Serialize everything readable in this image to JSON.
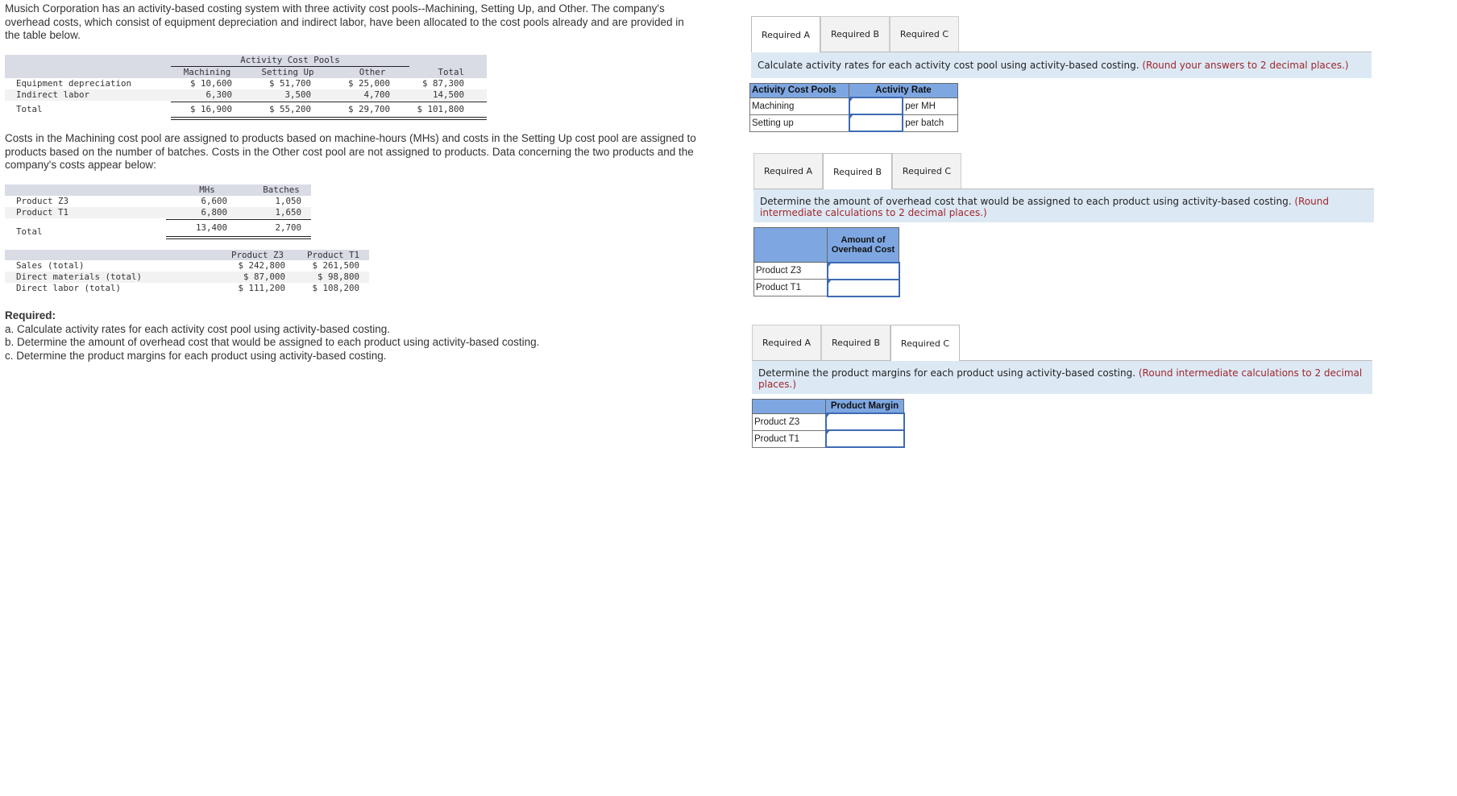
{
  "intro": "Musich Corporation has an activity-based costing system with three activity cost pools--Machining, Setting Up, and Other. The company's overhead costs, which consist of equipment depreciation and indirect labor, have been allocated to the cost pools already and are provided in the table below.",
  "cost_pools_table": {
    "group_header": "Activity Cost Pools",
    "columns": [
      "Machining",
      "Setting Up",
      "Other",
      "Total"
    ],
    "rows": [
      {
        "label": "Equipment depreciation",
        "values": [
          "$ 10,600",
          "$ 51,700",
          "$ 25,000",
          "$ 87,300"
        ]
      },
      {
        "label": "Indirect labor",
        "values": [
          "6,300",
          "3,500",
          "4,700",
          "14,500"
        ]
      },
      {
        "label": "Total",
        "values": [
          "$ 16,900",
          "$ 55,200",
          "$ 29,700",
          "$ 101,800"
        ]
      }
    ]
  },
  "para2": "Costs in the Machining cost pool are assigned to products based on machine-hours (MHs) and costs in the Setting Up cost pool are assigned to products based on the number of batches. Costs in the Other cost pool are not assigned to products. Data concerning the two products and the company's costs appear below:",
  "activity_table": {
    "columns": [
      "MHs",
      "Batches"
    ],
    "rows": [
      {
        "label": "Product Z3",
        "values": [
          "6,600",
          "1,050"
        ]
      },
      {
        "label": "Product T1",
        "values": [
          "6,800",
          "1,650"
        ]
      },
      {
        "label": "Total",
        "values": [
          "13,400",
          "2,700"
        ]
      }
    ]
  },
  "product_table": {
    "columns": [
      "Product Z3",
      "Product T1"
    ],
    "rows": [
      {
        "label": "Sales (total)",
        "values": [
          "$ 242,800",
          "$ 261,500"
        ]
      },
      {
        "label": "Direct materials (total)",
        "values": [
          "$ 87,000",
          "$ 98,800"
        ]
      },
      {
        "label": "Direct labor (total)",
        "values": [
          "$ 111,200",
          "$ 108,200"
        ]
      }
    ]
  },
  "required": {
    "heading": "Required:",
    "items": [
      "a. Calculate activity rates for each activity cost pool using activity-based costing.",
      "b. Determine the amount of overhead cost that would be assigned to each product using activity-based costing.",
      "c. Determine the product margins for each product using activity-based costing."
    ]
  },
  "tabs": [
    "Required A",
    "Required B",
    "Required C"
  ],
  "panel_a": {
    "active_tab": 0,
    "instruction": "Calculate activity rates for each activity cost pool using activity-based costing.",
    "note": "(Round your answers to 2 decimal places.)",
    "headers": [
      "Activity Cost Pools",
      "Activity Rate"
    ],
    "rows": [
      {
        "label": "Machining",
        "value": "",
        "unit": "per MH"
      },
      {
        "label": "Setting up",
        "value": "",
        "unit": "per batch"
      }
    ]
  },
  "panel_b": {
    "active_tab": 1,
    "instruction": "Determine the amount of overhead cost that would be assigned to each product using activity-based costing.",
    "note": "(Round intermediate calculations to 2 decimal places.)",
    "header_line1": "Amount of",
    "header_line2": "Overhead Cost",
    "rows": [
      {
        "label": "Product Z3",
        "value": ""
      },
      {
        "label": "Product T1",
        "value": ""
      }
    ]
  },
  "panel_c": {
    "active_tab": 2,
    "instruction": "Determine the product margins for each product using activity-based costing.",
    "note": "(Round intermediate calculations to 2 decimal places.)",
    "header": "Product Margin",
    "rows": [
      {
        "label": "Product Z3",
        "value": ""
      },
      {
        "label": "Product T1",
        "value": ""
      }
    ]
  },
  "colors": {
    "instruction_bg": "#dce9f5",
    "table_header_bg": "#7ea7e2",
    "note_red": "#a0262b",
    "input_border": "#3e6ab3",
    "data_band": "#d9dbe5"
  }
}
